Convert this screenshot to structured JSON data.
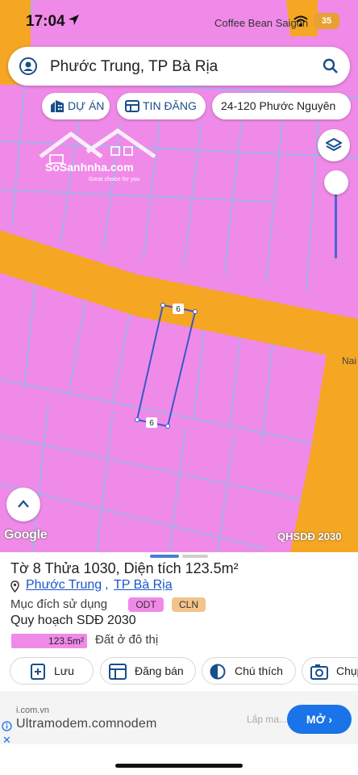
{
  "status_bar": {
    "time": "17:04",
    "poi_label": "Coffee Bean Saigon",
    "battery": "35"
  },
  "search": {
    "query": "Phước Trung, TP Bà Rịa"
  },
  "chips": {
    "project": "DỰ ÁN",
    "listing": "TIN ĐĂNG",
    "address": "24-120 Phước Nguyên"
  },
  "watermark": {
    "brand": "SoSanhnha.com",
    "tagline": "Great choice for you"
  },
  "map": {
    "edge_label_top": "6",
    "edge_label_bottom": "6",
    "poi_partial": "Nai",
    "attribution": "Google",
    "layer_name": "QHSDĐ 2030",
    "colors": {
      "residential_land": "#f08ae8",
      "road": "#f5a623",
      "parcel_outline": "#3a58c8"
    }
  },
  "parcel": {
    "title": "Tờ 8 Thửa 1030, Diện tích 123.5m²",
    "ward": "Phước Trung",
    "comma": ",",
    "city": "TP Bà Rịa",
    "purpose_label": "Mục đích sử dụng",
    "purpose_tags": [
      "ODT",
      "CLN"
    ],
    "plan_label": "Quy hoạch SDĐ 2030",
    "plan_area": "123.5m²",
    "plan_use": "Đất ở đô thị"
  },
  "actions": {
    "save": "Lưu",
    "sell": "Đăng bán",
    "legend": "Chú thích",
    "photo": "Chụp"
  },
  "ad": {
    "domain": "i.com.vn",
    "headline": "Ultramodem.comnodem",
    "faded_text": "Lắp ma...",
    "cta": "MỞ ›"
  }
}
